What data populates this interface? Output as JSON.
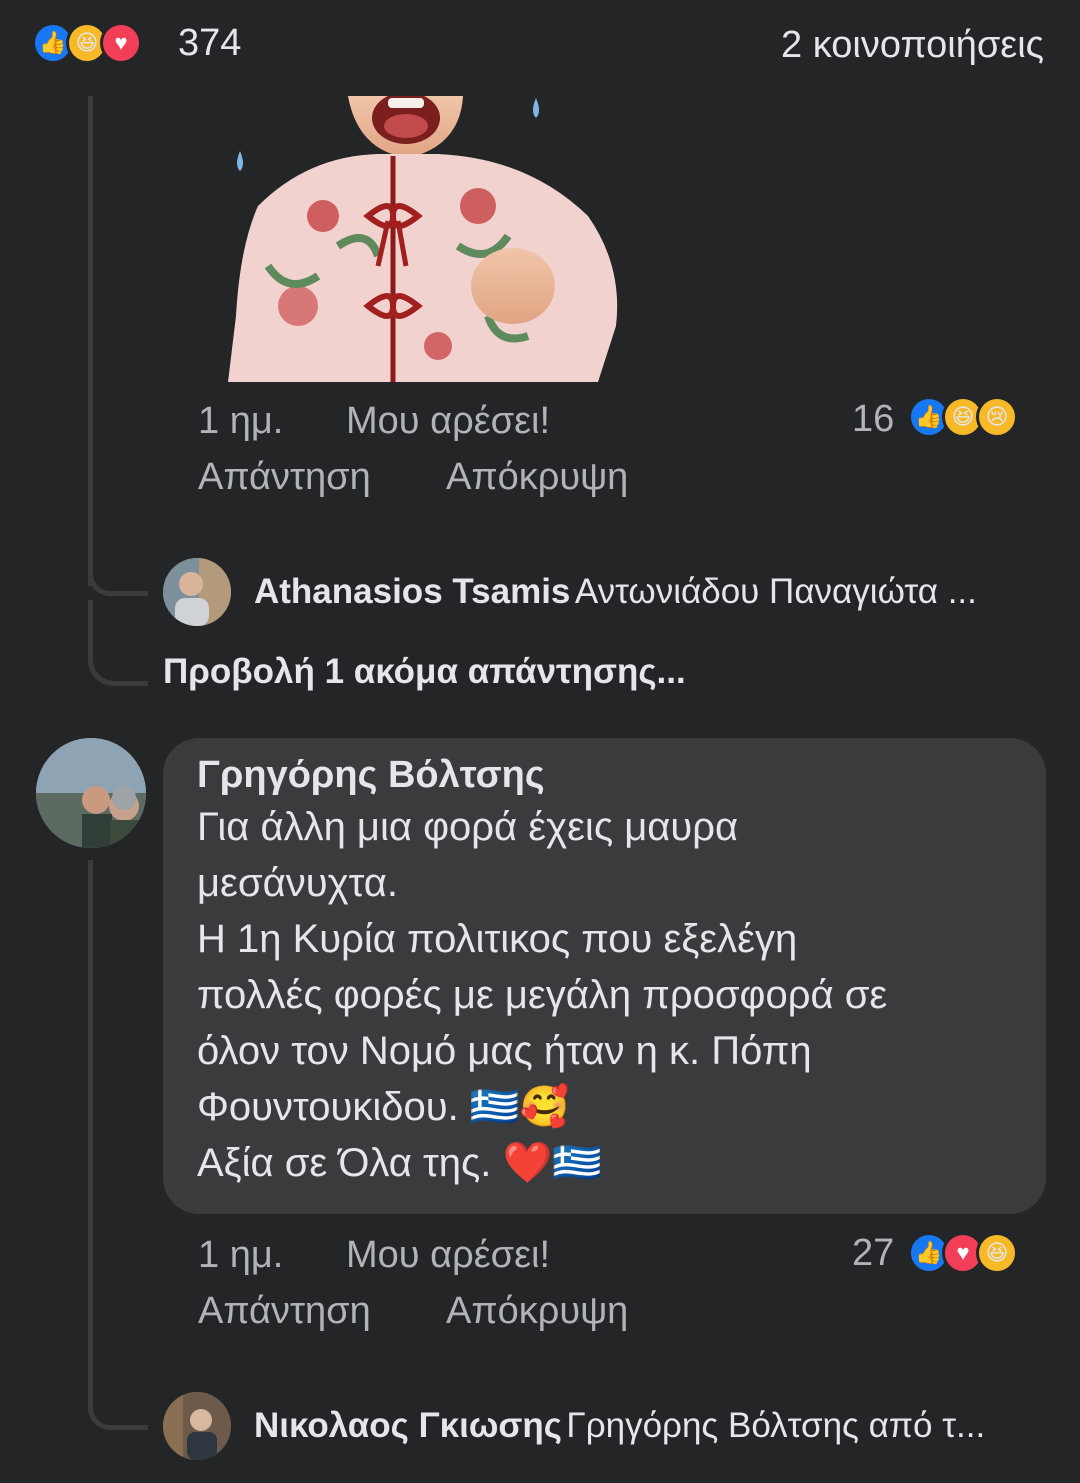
{
  "header": {
    "reaction_count": "374",
    "shares": "2 κοινοποιήσεις"
  },
  "comment1": {
    "time": "1 ημ.",
    "like_label": "Μου αρέσει!",
    "reply_label": "Απάντηση",
    "hide_label": "Απόκρυψη",
    "reaction_count": "16",
    "reactions": [
      "like",
      "haha",
      "sad"
    ]
  },
  "reply1": {
    "author": "Athanasios Tsamis",
    "text": "Αντωνιάδου Παναγιώτα ..."
  },
  "view_more": "Προβολή 1 ακόμα απάντησης...",
  "comment2": {
    "author": "Γρηγόρης Βόλτσης",
    "lines": [
      "Για άλλη μια φορά έχεις μαυρα",
      "μεσάνυχτα.",
      "Η 1η  Κυρία πολιτικος που εξελέγη",
      "πολλές φορές με μεγάλη προσφορά σε",
      "όλον τον Νομό μας ήταν η κ. Πόπη",
      "Φουντουκιδου. 🇬🇷🥰",
      "Αξία σε Όλα της. ❤️🇬🇷"
    ],
    "time": "1 ημ.",
    "like_label": "Μου αρέσει!",
    "reply_label": "Απάντηση",
    "hide_label": "Απόκρυψη",
    "reaction_count": "27",
    "reactions": [
      "like",
      "love",
      "haha"
    ]
  },
  "reply2": {
    "author": "Νικολαος Γκιωσης",
    "text": "Γρηγόρης Βόλτσης από τ..."
  },
  "colors": {
    "background": "#242526",
    "bubble": "#3a3b3c",
    "like": "#1877f2",
    "love": "#f33e58",
    "haha": "#f7b928"
  }
}
